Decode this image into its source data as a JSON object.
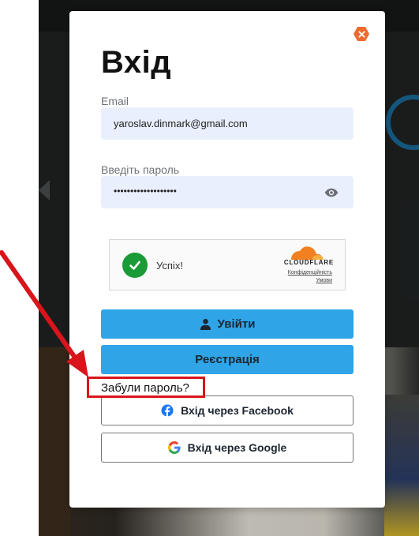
{
  "modal": {
    "title": "Вхід",
    "email": {
      "label": "Email",
      "value": "yaroslav.dinmark@gmail.com"
    },
    "password": {
      "label": "Введіть пароль",
      "masked_value": "•••••••••••••••••••"
    },
    "captcha": {
      "status": "Успіх!",
      "brand": "CLOUDFLARE",
      "privacy_link": "Конфіденційність",
      "terms_link": "Умови"
    },
    "login_button": "Увійти",
    "register_button": "Реєстрація",
    "forgot_password": "Забули пароль?",
    "facebook_button": "Вхід через Facebook",
    "google_button": "Вхід через Google"
  },
  "icons": {
    "close": "close-icon",
    "eye": "eye-icon",
    "check": "check-icon",
    "user": "user-icon",
    "facebook": "facebook-icon",
    "google": "google-icon"
  },
  "colors": {
    "primary_button": "#2fa4e7",
    "input_background": "#e9effd",
    "close_button": "#ee6a2f",
    "success_green": "#1a9b38",
    "annotation_red": "#d9141b",
    "facebook_blue": "#1877f2",
    "cloudflare_orange": "#f38020"
  }
}
